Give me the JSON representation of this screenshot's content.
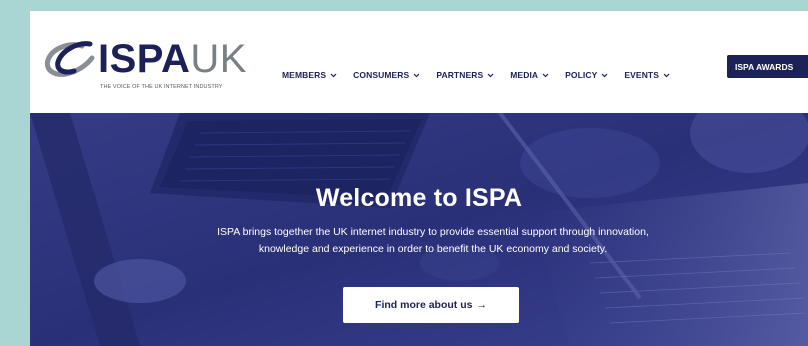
{
  "logo": {
    "part1": "ISPA",
    "part2": "UK",
    "tagline": "THE VOICE OF THE UK INTERNET INDUSTRY"
  },
  "nav": {
    "items": [
      {
        "label": "MEMBERS"
      },
      {
        "label": "CONSUMERS"
      },
      {
        "label": "PARTNERS"
      },
      {
        "label": "MEDIA"
      },
      {
        "label": "POLICY"
      },
      {
        "label": "EVENTS"
      }
    ],
    "awards_label": "ISPA AWARDS"
  },
  "hero": {
    "title": "Welcome to ISPA",
    "description": "ISPA brings together the UK internet industry to provide essential support through innovation, knowledge and experience in order to benefit the UK economy and society.",
    "cta_label": "Find more about us",
    "cta_arrow": "→"
  },
  "colors": {
    "navy": "#1c2157",
    "hero_overlay": "#2b3178",
    "page_bg": "#a9d6d3"
  },
  "icons": [
    "ispa-logo-icon",
    "chevron-down-icon",
    "arrow-right-icon"
  ]
}
